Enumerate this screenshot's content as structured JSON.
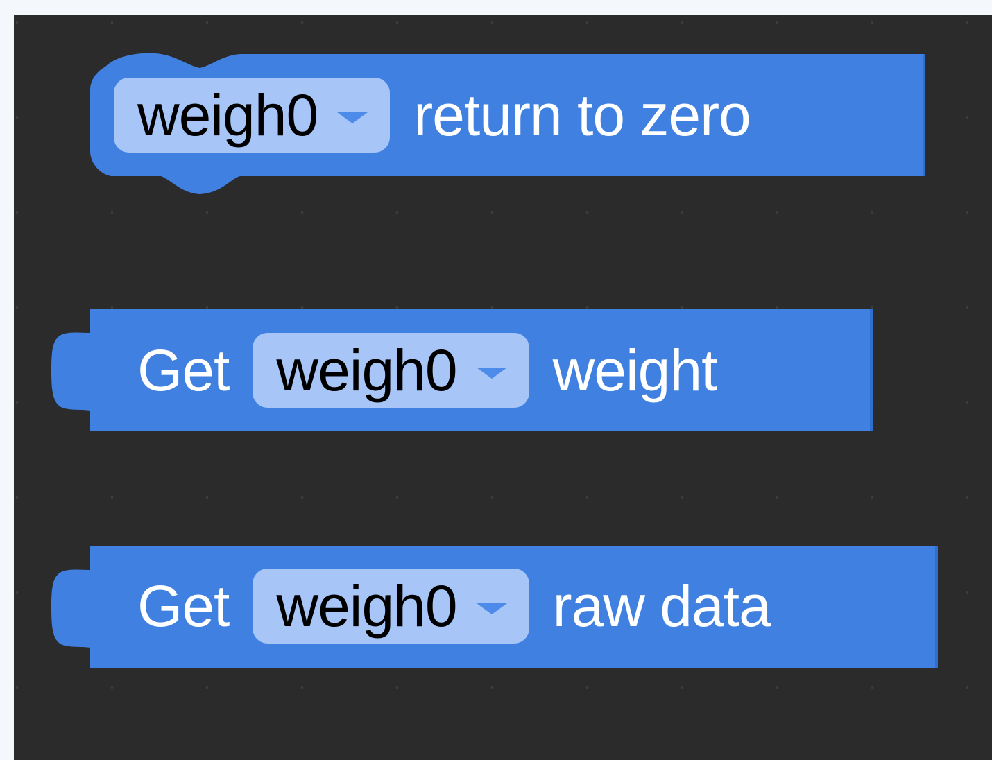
{
  "workspace": {
    "background_color": "#2b2b2b",
    "block_color": "#3f80e0",
    "dropdown_color": "#a7c5f6"
  },
  "blocks": [
    {
      "shape": "statement-cap",
      "dropdown_value": "weigh0",
      "dropdown_icon": "chevron-down-icon",
      "suffix": "return to zero"
    },
    {
      "shape": "value-reporter",
      "prefix": "Get",
      "dropdown_value": "weigh0",
      "dropdown_icon": "chevron-down-icon",
      "suffix": "weight"
    },
    {
      "shape": "value-reporter",
      "prefix": "Get",
      "dropdown_value": "weigh0",
      "dropdown_icon": "chevron-down-icon",
      "suffix": "raw data"
    }
  ]
}
